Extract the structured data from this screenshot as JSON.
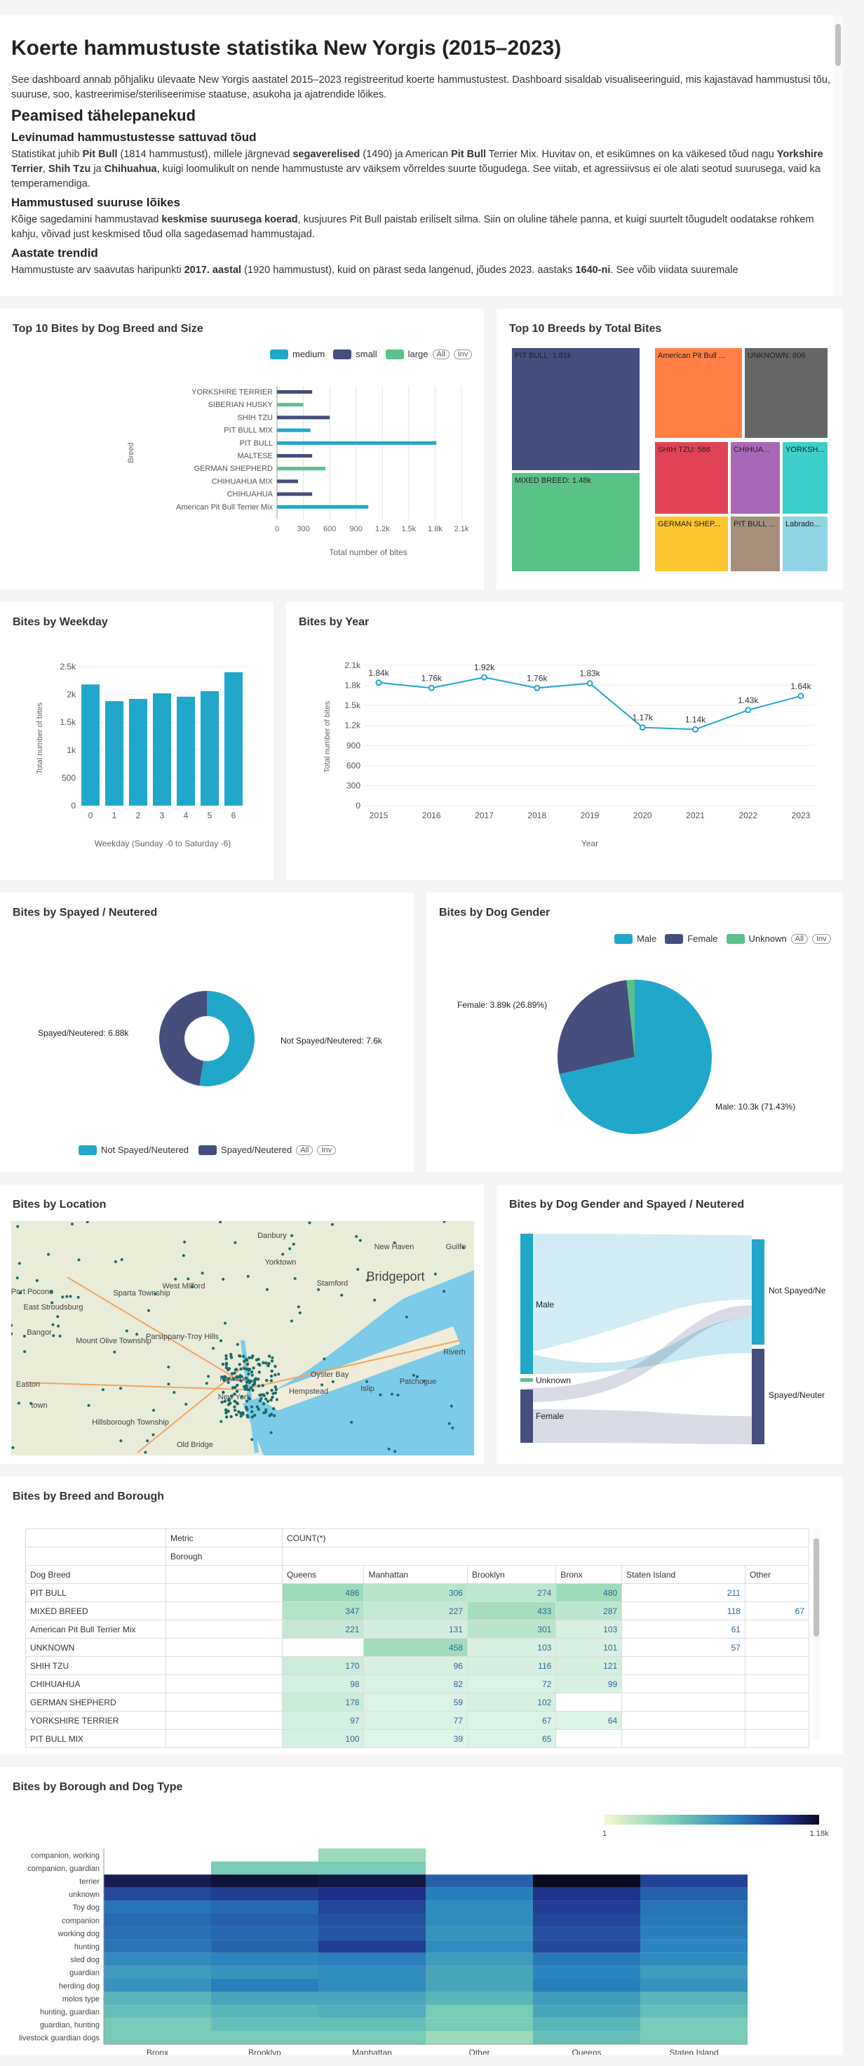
{
  "intro": {
    "title": "Koerte hammustuste statistika New Yorgis (2015–2023)",
    "lead": "See dashboard annab põhjaliku ülevaate New Yorgis aastatel 2015–2023 registreeritud koerte hammustustest. Dashboard sisaldab visualiseeringuid, mis kajastavad hammustusi tõu, suuruse, soo, kastreerimise/steriliseerimise staatuse, asukoha ja ajatrendide lõikes.",
    "h_main": "Peamised tähelepanekud",
    "h_breeds": "Levinumad hammustustesse sattuvad tõud",
    "breeds_text": "Statistikat juhib Pit Bull (1814 hammustust), millele järgnevad segaverelised (1490) ja American Pit Bull Terrier Mix. Huvitav on, et esikümnes on ka väikesed tõud nagu Yorkshire Terrier, Shih Tzu ja Chihuahua, kuigi loomulikult on nende hammustuste arv väiksem võrreldes suurte tõugudega. See viitab, et agressiivsus ei ole alati seotud suurusega, vaid ka temperamendiga.",
    "h_size": "Hammustused suuruse lõikes",
    "size_text": "Kõige sagedamini hammustavad keskmise suurusega koerad, kusjuures Pit Bull paistab eriliselt silma. Siin on oluline tähele panna, et kuigi suurtelt tõugudelt oodatakse rohkem kahju, võivad just keskmised tõud olla sagedasemad hammustajad.",
    "h_trend": "Aastate trendid",
    "trend_text": "Hammustuste arv saavutas haripunkti 2017. aastal (1920 hammustust), kuid on pärast seda langenud, jõudes 2023. aastaks 1640-ni. See võib viidata suuremale"
  },
  "colors": {
    "teal": "#20a7c9",
    "navy": "#454e7c",
    "green": "#5ac189",
    "orange": "#ff7f44",
    "gray": "#666666",
    "red": "#e04355",
    "purple": "#a868b7",
    "cyan": "#3cceca",
    "yellow": "#fdc530",
    "tan": "#a38f7c",
    "lightblue": "#8fd3e4"
  },
  "bar_breed_size": {
    "title": "Top 10 Bites by Dog Breed and Size",
    "legend": [
      "medium",
      "small",
      "large"
    ],
    "legend_all": "All",
    "legend_inv": "Inv",
    "ylabel": "Breed",
    "xlabel": "Total  number of bites",
    "chart_data": {
      "type": "bar",
      "orientation": "horizontal",
      "categories": [
        "YORKSHIRE TERRIER",
        "SIBERIAN HUSKY",
        "SHIH TZU",
        "PIT BULL MIX",
        "PIT BULL",
        "MALTESE",
        "GERMAN SHEPHERD",
        "CHIHUAHUA MIX",
        "CHIHUAHUA",
        "American Pit Bull Terrier Mix"
      ],
      "series": [
        {
          "name": "medium",
          "values": [
            0,
            0,
            0,
            380,
            1814,
            0,
            0,
            0,
            0,
            1040
          ]
        },
        {
          "name": "small",
          "values": [
            400,
            0,
            600,
            0,
            0,
            400,
            0,
            240,
            400,
            0
          ]
        },
        {
          "name": "large",
          "values": [
            0,
            300,
            0,
            0,
            0,
            0,
            550,
            0,
            0,
            0
          ]
        }
      ],
      "xticks": [
        "0",
        "300",
        "600",
        "900",
        "1.2k",
        "1.5k",
        "1.8k",
        "2.1k"
      ],
      "xlim": [
        0,
        2100
      ]
    }
  },
  "treemap": {
    "title": "Top 10 Breeds by Total Bites",
    "chart_data": {
      "type": "treemap",
      "items": [
        {
          "label": "PIT BULL: 1.81k",
          "value": 1814
        },
        {
          "label": "MIXED BREED: 1.48k",
          "value": 1480
        },
        {
          "label": "American Pit Bull ...",
          "value": 950
        },
        {
          "label": "UNKNOWN: 806",
          "value": 806
        },
        {
          "label": "SHIH TZU: 566",
          "value": 566
        },
        {
          "label": "CHIHUA...",
          "value": 380
        },
        {
          "label": "YORKSH...",
          "value": 380
        },
        {
          "label": "GERMAN SHEP...",
          "value": 400
        },
        {
          "label": "PIT BULL ...",
          "value": 300
        },
        {
          "label": "Labrado...",
          "value": 300
        }
      ]
    }
  },
  "weekday": {
    "title": "Bites by Weekday",
    "xlabel": "Weekday (Sunday -0 to Saturday -6)",
    "ylabel": "Total  number of bites",
    "chart_data": {
      "type": "bar",
      "categories": [
        "0",
        "1",
        "2",
        "3",
        "4",
        "5",
        "6"
      ],
      "values": [
        2180,
        1880,
        1920,
        2020,
        1960,
        2060,
        2400
      ],
      "yticks": [
        "0",
        "500",
        "1k",
        "1.5k",
        "2k",
        "2.5k"
      ],
      "ylim": [
        0,
        2500
      ]
    }
  },
  "year": {
    "title": "Bites by Year",
    "xlabel": "Year",
    "ylabel": "Total  number of bites",
    "chart_data": {
      "type": "line",
      "x": [
        "2015",
        "2016",
        "2017",
        "2018",
        "2019",
        "2020",
        "2021",
        "2022",
        "2023"
      ],
      "values": [
        1840,
        1760,
        1920,
        1760,
        1830,
        1170,
        1140,
        1430,
        1640
      ],
      "labels": [
        "1.84k",
        "1.76k",
        "1.92k",
        "1.76k",
        "1.83k",
        "1.17k",
        "1.14k",
        "1.43k",
        "1.64k"
      ],
      "yticks": [
        "0",
        "300",
        "600",
        "900",
        "1.2k",
        "1.5k",
        "1.8k",
        "2.1k"
      ],
      "ylim": [
        0,
        2100
      ]
    }
  },
  "spayed": {
    "title": "Bites by Spayed / Neutered",
    "legend": [
      "Not Spayed/Neutered",
      "Spayed/Neutered"
    ],
    "legend_all": "All",
    "legend_inv": "Inv",
    "chart_data": {
      "type": "pie",
      "donut": true,
      "slices": [
        {
          "name": "Not Spayed/Neutered",
          "value": 7600,
          "label": "Not Spayed/Neutered: 7.6k"
        },
        {
          "name": "Spayed/Neutered",
          "value": 6880,
          "label": "Spayed/Neutered: 6.88k"
        }
      ]
    }
  },
  "gender": {
    "title": "Bites by Dog Gender",
    "legend": [
      "Male",
      "Female",
      "Unknown"
    ],
    "legend_all": "All",
    "legend_inv": "Inv",
    "chart_data": {
      "type": "pie",
      "slices": [
        {
          "name": "Male",
          "value": 71.43,
          "label": "Male: 10.3k (71.43%)"
        },
        {
          "name": "Female",
          "value": 26.89,
          "label": "Female: 3.89k (26.89%)"
        },
        {
          "name": "Unknown",
          "value": 1.68,
          "label": ""
        }
      ]
    }
  },
  "location": {
    "title": "Bites by Location",
    "places": [
      "Danbury",
      "New Haven",
      "Guilfo",
      "Yorktown",
      "Bridgeport",
      "Stamford",
      "Sparta Township",
      "West Milford",
      "Port Pocono",
      "East Stroudsburg",
      "Bangor",
      "Mount Olive Township",
      "Parsippany-Troy Hills",
      "Newark",
      "New York",
      "Hempstead",
      "Oyster Bay",
      "Islip",
      "Patchogue",
      "Riverh",
      "Easton",
      "Hillsborough Township",
      "Old Bridge",
      "town"
    ]
  },
  "sankey": {
    "title": "Bites by Dog Gender and Spayed / Neutered",
    "left": [
      "Male",
      "Unknown",
      "Female"
    ],
    "right": [
      "Not Spayed/Ne",
      "Spayed/Neuter"
    ]
  },
  "pivot": {
    "title": "Bites by Breed and Borough",
    "metric_label": "Metric",
    "borough_label": "Borough",
    "count_label": "COUNT(*)",
    "breed_label": "Dog Breed",
    "columns": [
      "Queens",
      "Manhattan",
      "Brooklyn",
      "Bronx",
      "Staten Island",
      "Other"
    ],
    "rows": [
      {
        "breed": "PIT BULL",
        "values": [
          "486",
          "306",
          "274",
          "480",
          "211",
          ""
        ]
      },
      {
        "breed": "MIXED BREED",
        "values": [
          "347",
          "227",
          "433",
          "287",
          "118",
          "67"
        ]
      },
      {
        "breed": "American Pit Bull Terrier Mix",
        "values": [
          "221",
          "131",
          "301",
          "103",
          "61",
          ""
        ]
      },
      {
        "breed": "UNKNOWN",
        "values": [
          "",
          "458",
          "103",
          "101",
          "57",
          ""
        ]
      },
      {
        "breed": "SHIH TZU",
        "values": [
          "170",
          "96",
          "116",
          "121",
          "",
          ""
        ]
      },
      {
        "breed": "CHIHUAHUA",
        "values": [
          "98",
          "82",
          "72",
          "99",
          "",
          ""
        ]
      },
      {
        "breed": "GERMAN SHEPHERD",
        "values": [
          "178",
          "59",
          "102",
          "",
          "",
          ""
        ]
      },
      {
        "breed": "YORKSHIRE TERRIER",
        "values": [
          "97",
          "77",
          "67",
          "64",
          "",
          ""
        ]
      },
      {
        "breed": "PIT BULL MIX",
        "values": [
          "100",
          "39",
          "65",
          "",
          "",
          ""
        ]
      }
    ]
  },
  "heatmap": {
    "title": "Bites by Borough and Dog Type",
    "scale_min": "1",
    "scale_max": "1.18k",
    "chart_data": {
      "type": "heatmap",
      "x": [
        "Bronx",
        "Brooklyn",
        "Manhattan",
        "Other",
        "Queens",
        "Staten Island"
      ],
      "y": [
        "companion, working",
        "companion, guardian",
        "terrier",
        "unknown",
        "Toy dog",
        "companion",
        "working dog",
        "hunting",
        "sled dog",
        "guardian",
        "herding dog",
        "molos type",
        "hunting, guardian",
        "guardian, hunting",
        "livestock guardian dogs"
      ],
      "values": [
        [
          0,
          0,
          5,
          0,
          0,
          0
        ],
        [
          0,
          10,
          10,
          0,
          0,
          0
        ],
        [
          700,
          900,
          800,
          150,
          1180,
          280
        ],
        [
          240,
          300,
          400,
          80,
          380,
          150
        ],
        [
          100,
          120,
          250,
          60,
          300,
          100
        ],
        [
          120,
          150,
          200,
          60,
          250,
          90
        ],
        [
          110,
          130,
          180,
          50,
          210,
          80
        ],
        [
          100,
          140,
          300,
          60,
          240,
          70
        ],
        [
          60,
          70,
          80,
          40,
          90,
          60
        ],
        [
          40,
          50,
          60,
          30,
          70,
          40
        ],
        [
          50,
          80,
          60,
          30,
          80,
          50
        ],
        [
          20,
          30,
          30,
          20,
          40,
          20
        ],
        [
          15,
          20,
          25,
          10,
          30,
          15
        ],
        [
          10,
          15,
          15,
          10,
          20,
          10
        ],
        [
          10,
          10,
          10,
          5,
          15,
          10
        ]
      ],
      "xlim_note": "colorscale 1 to 1180"
    }
  }
}
